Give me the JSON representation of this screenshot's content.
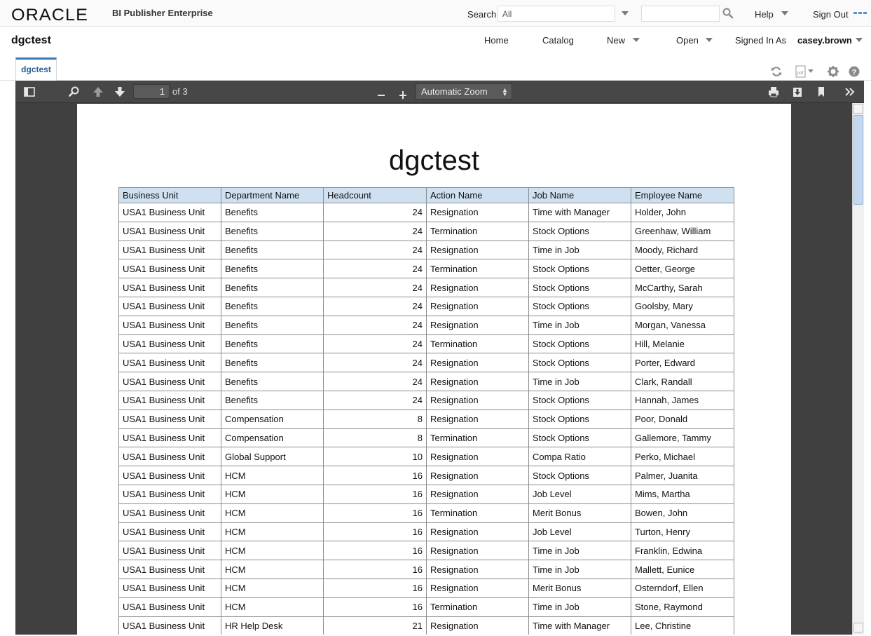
{
  "global_header": {
    "brand": "ORACLE",
    "product": "BI Publisher Enterprise",
    "search_label": "Search",
    "search_scope": "All",
    "search_value": "",
    "help_label": "Help",
    "signout_label": "Sign Out"
  },
  "app_bar": {
    "page_name": "dgctest",
    "nav": {
      "home": "Home",
      "catalog": "Catalog",
      "new": "New",
      "open": "Open",
      "signed_in_as": "Signed In As",
      "user": "casey.brown"
    }
  },
  "tab": {
    "label": "dgctest"
  },
  "viewer": {
    "page_number": "1",
    "page_of": "of 3",
    "zoom": "Automatic Zoom"
  },
  "report": {
    "title": "dgctest",
    "columns": [
      "Business Unit",
      "Department Name",
      "Headcount",
      "Action Name",
      "Job Name",
      "Employee Name"
    ],
    "rows": [
      [
        "USA1 Business Unit",
        "Benefits",
        "24",
        "Resignation",
        "Time with Manager",
        "Holder, John"
      ],
      [
        "USA1 Business Unit",
        "Benefits",
        "24",
        "Termination",
        "Stock Options",
        "Greenhaw, William"
      ],
      [
        "USA1 Business Unit",
        "Benefits",
        "24",
        "Resignation",
        "Time in Job",
        "Moody, Richard"
      ],
      [
        "USA1 Business Unit",
        "Benefits",
        "24",
        "Termination",
        "Stock Options",
        "Oetter, George"
      ],
      [
        "USA1 Business Unit",
        "Benefits",
        "24",
        "Resignation",
        "Stock Options",
        "McCarthy, Sarah"
      ],
      [
        "USA1 Business Unit",
        "Benefits",
        "24",
        "Resignation",
        "Stock Options",
        "Goolsby, Mary"
      ],
      [
        "USA1 Business Unit",
        "Benefits",
        "24",
        "Resignation",
        "Time in Job",
        "Morgan, Vanessa"
      ],
      [
        "USA1 Business Unit",
        "Benefits",
        "24",
        "Termination",
        "Stock Options",
        "Hill, Melanie"
      ],
      [
        "USA1 Business Unit",
        "Benefits",
        "24",
        "Resignation",
        "Stock Options",
        "Porter, Edward"
      ],
      [
        "USA1 Business Unit",
        "Benefits",
        "24",
        "Resignation",
        "Time in Job",
        "Clark, Randall"
      ],
      [
        "USA1 Business Unit",
        "Benefits",
        "24",
        "Resignation",
        "Stock Options",
        "Hannah, James"
      ],
      [
        "USA1 Business Unit",
        "Compensation",
        "8",
        "Resignation",
        "Stock Options",
        "Poor, Donald"
      ],
      [
        "USA1 Business Unit",
        "Compensation",
        "8",
        "Termination",
        "Stock Options",
        "Gallemore, Tammy"
      ],
      [
        "USA1 Business Unit",
        "Global Support",
        "10",
        "Resignation",
        "Compa Ratio",
        "Perko, Michael"
      ],
      [
        "USA1 Business Unit",
        "HCM",
        "16",
        "Resignation",
        "Stock Options",
        "Palmer, Juanita"
      ],
      [
        "USA1 Business Unit",
        "HCM",
        "16",
        "Resignation",
        "Job Level",
        "Mims, Martha"
      ],
      [
        "USA1 Business Unit",
        "HCM",
        "16",
        "Termination",
        "Merit Bonus",
        "Bowen, John"
      ],
      [
        "USA1 Business Unit",
        "HCM",
        "16",
        "Resignation",
        "Job Level",
        "Turton, Henry"
      ],
      [
        "USA1 Business Unit",
        "HCM",
        "16",
        "Resignation",
        "Time in Job",
        "Franklin, Edwina"
      ],
      [
        "USA1 Business Unit",
        "HCM",
        "16",
        "Resignation",
        "Time in Job",
        "Mallett, Eunice"
      ],
      [
        "USA1 Business Unit",
        "HCM",
        "16",
        "Resignation",
        "Merit Bonus",
        "Osterndorf, Ellen"
      ],
      [
        "USA1 Business Unit",
        "HCM",
        "16",
        "Termination",
        "Time in Job",
        "Stone, Raymond"
      ],
      [
        "USA1 Business Unit",
        "HR Help Desk",
        "21",
        "Resignation",
        "Time with Manager",
        "Lee, Christine"
      ]
    ]
  },
  "colors": {
    "accent": "#3a78b8",
    "header_cell": "#cfe0f1",
    "viewer_bg": "#404040",
    "toolbar_bg": "#474747"
  },
  "icons": {
    "search_go": "search-icon",
    "menu": "app-menu-icon",
    "refresh": "refresh-icon",
    "pdf": "pdf-export-icon",
    "settings": "gear-icon",
    "help": "help-icon",
    "sidebar": "sidebar-toggle-icon",
    "find": "find-icon",
    "prev": "arrow-up-icon",
    "next": "arrow-down-icon",
    "zoom_out": "minus-icon",
    "zoom_in": "plus-icon",
    "print": "print-icon",
    "download": "download-icon",
    "bookmark": "bookmark-icon",
    "tools": "double-chevron-icon"
  }
}
